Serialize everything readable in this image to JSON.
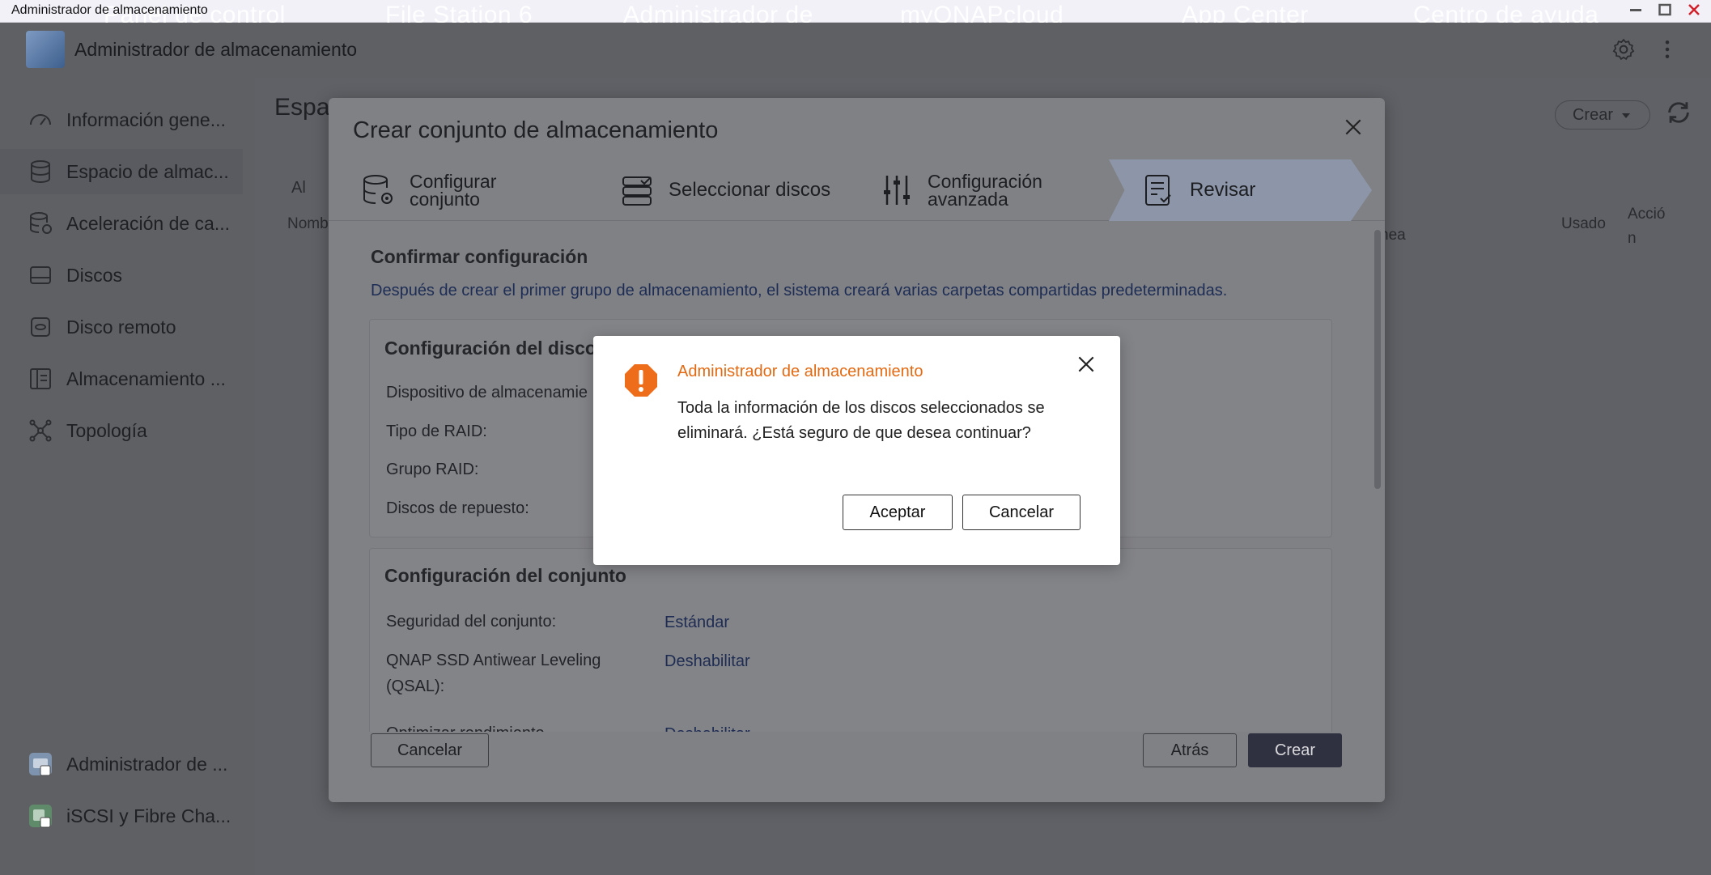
{
  "window": {
    "title": "Administrador de almacenamiento",
    "ghost_tabs": [
      "Panel de control",
      "File Station 6",
      "Administrador de",
      "myQNAPcloud",
      "App Center",
      "Centro de ayuda"
    ]
  },
  "app": {
    "title": "Administrador de almacenamiento"
  },
  "sidebar": {
    "items": [
      {
        "label": "Información gene...",
        "icon": "dashboard-icon"
      },
      {
        "label": "Espacio de almac...",
        "icon": "database-icon"
      },
      {
        "label": "Aceleración de ca...",
        "icon": "cache-icon"
      },
      {
        "label": "Discos",
        "icon": "disk-icon"
      },
      {
        "label": "Disco remoto",
        "icon": "remote-disk-icon"
      },
      {
        "label": "Almacenamiento ...",
        "icon": "external-storage-icon"
      },
      {
        "label": "Topología",
        "icon": "topology-icon"
      }
    ],
    "bottom_items": [
      {
        "label": "Administrador de ...",
        "icon": "app-shortcut-icon"
      },
      {
        "label": "iSCSI y Fibre Cha...",
        "icon": "iscsi-app-icon"
      }
    ]
  },
  "content": {
    "title": "Espa",
    "create_label": "Crear",
    "tab_fragment": "Al",
    "col_name": "Nomb",
    "col_fragment": "nea",
    "col_used": "Usado",
    "col_action": "Acción"
  },
  "modal": {
    "title": "Crear conjunto de almacenamiento",
    "steps": [
      {
        "label_line1": "Configurar",
        "label_line2": "conjunto"
      },
      {
        "label_line1": "Seleccionar discos",
        "label_line2": ""
      },
      {
        "label_line1": "Configuración",
        "label_line2": "avanzada"
      },
      {
        "label_line1": "Revisar",
        "label_line2": ""
      }
    ],
    "confirm_title": "Confirmar configuración",
    "confirm_note": "Después de crear el primer grupo de almacenamiento, el sistema creará varias carpetas compartidas predeterminadas.",
    "disk_section": {
      "title": "Configuración del disco",
      "rows": [
        "Dispositivo de almacenamie",
        "Tipo de RAID:",
        "Grupo RAID:",
        "Discos de repuesto:"
      ]
    },
    "pool_section": {
      "title": "Configuración del conjunto",
      "rows": [
        {
          "label": "Seguridad del conjunto:",
          "value": "Estándar"
        },
        {
          "label_line1": "QNAP SSD Antiwear Leveling",
          "label_line2": "(QSAL):",
          "value": "Deshabilitar"
        },
        {
          "label": "Optimizar rendimiento",
          "value": "Deshabilitar"
        }
      ]
    },
    "buttons": {
      "cancel": "Cancelar",
      "back": "Atrás",
      "create": "Crear"
    }
  },
  "alert": {
    "title": "Administrador de almacenamiento",
    "message": "Toda la información de los discos seleccionados se eliminará. ¿Está seguro de que desea continuar?",
    "accept": "Aceptar",
    "cancel": "Cancelar",
    "accent_color": "#e36a12"
  }
}
